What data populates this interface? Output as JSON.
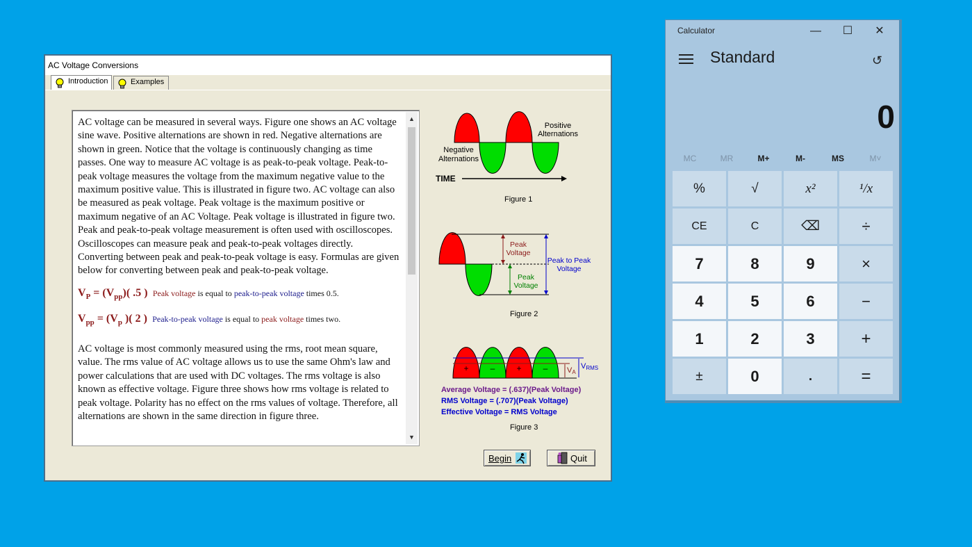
{
  "ac_window": {
    "title": "AC Voltage Conversions",
    "tabs": [
      {
        "label": "Introduction",
        "active": true,
        "icon": "lightbulb-icon"
      },
      {
        "label": "Examples",
        "active": false,
        "icon": "lightbulb-icon"
      }
    ],
    "intro_paragraph": "AC voltage can be measured in several ways. Figure one shows an AC voltage sine wave. Positive alternations are shown in red. Negative alternations are shown in green. Notice that the voltage is continuously changing as time passes. One way to measure AC voltage is as peak-to-peak voltage. Peak-to-peak voltage measures the voltage from the maximum negative value to the maximum positive value. This is illustrated in figure two. AC voltage can also be measured as peak voltage. Peak voltage is the maximum positive or maximum negative of an AC Voltage. Peak voltage is illustrated in figure two. Peak and peak-to-peak voltage measurement is often used with oscilloscopes. Oscilloscopes can measure peak and peak-to-peak voltages directly. Converting between peak and peak-to-peak voltage is easy. Formulas are given below for converting between peak and peak-to-peak voltage.",
    "formula1": {
      "lhs": "V",
      "lhs_sub": "P",
      "eq": " = (V",
      "rhs_sub": "pp",
      "rhs_tail": ")( .5 )",
      "desc_a": "Peak voltage",
      "desc_b": " is equal to ",
      "desc_c": "peak-to-peak voltage",
      "desc_d": " times 0.5."
    },
    "formula2": {
      "lhs": "V",
      "lhs_sub": "pp",
      "eq": " = (V",
      "rhs_sub": "p",
      "rhs_tail": " )( 2 )",
      "desc_a": "Peak-to-peak voltage",
      "desc_b": " is equal to ",
      "desc_c": "peak voltage",
      "desc_d": " times two."
    },
    "rms_paragraph": "AC voltage is most commonly measured using the rms, root mean square, value. The rms value of AC voltage allows us to use the same Ohm's law and power calculations that are used with DC voltages. The rms voltage is also known as effective voltage. Figure three shows how rms voltage is related to peak voltage. Polarity has no effect on the rms values of voltage. Therefore, all alternations are shown in the same direction in figure three.",
    "figure1": {
      "positive_label_1": "Positive",
      "positive_label_2": "Alternations",
      "negative_label_1": "Negative",
      "negative_label_2": "Alternations",
      "time_label": "TIME",
      "caption": "Figure 1"
    },
    "figure2": {
      "peak_label_1": "Peak",
      "peak_label_2": "Voltage",
      "peak2_label_1": "Peak",
      "peak2_label_2": "Voltage",
      "p2p_label_1": "Peak to Peak",
      "p2p_label_2": "Voltage",
      "caption": "Figure 2"
    },
    "figure3": {
      "plus": "+",
      "minus": "–",
      "va_label": "V",
      "va_sub": "A",
      "vrms_label": "V",
      "vrms_sub": "RMS",
      "line1": "Average Voltage = (.637)(Peak Voltage)",
      "line2": "RMS Voltage = (.707)(Peak Voltage)",
      "line3": "Effective Voltage = RMS Voltage",
      "caption": "Figure 3"
    },
    "buttons": {
      "begin": "Begin",
      "quit": "Quit"
    },
    "colors": {
      "positive": "#FF0000",
      "negative": "#00DD00"
    }
  },
  "calculator": {
    "title": "Calculator",
    "mode": "Standard",
    "display": "0",
    "window_controls": {
      "minimize": "—",
      "maximize": "☐",
      "close": "✕"
    },
    "memory": [
      {
        "label": "MC",
        "enabled": false
      },
      {
        "label": "MR",
        "enabled": false
      },
      {
        "label": "M+",
        "enabled": true
      },
      {
        "label": "M-",
        "enabled": true
      },
      {
        "label": "MS",
        "enabled": true
      },
      {
        "label": "M˅",
        "enabled": false
      }
    ],
    "keys": [
      [
        "%",
        "√",
        "x²",
        "¹/x"
      ],
      [
        "CE",
        "C",
        "⌫",
        "÷"
      ],
      [
        "7",
        "8",
        "9",
        "×"
      ],
      [
        "4",
        "5",
        "6",
        "−"
      ],
      [
        "1",
        "2",
        "3",
        "+"
      ],
      [
        "±",
        "0",
        ".",
        "="
      ]
    ]
  }
}
